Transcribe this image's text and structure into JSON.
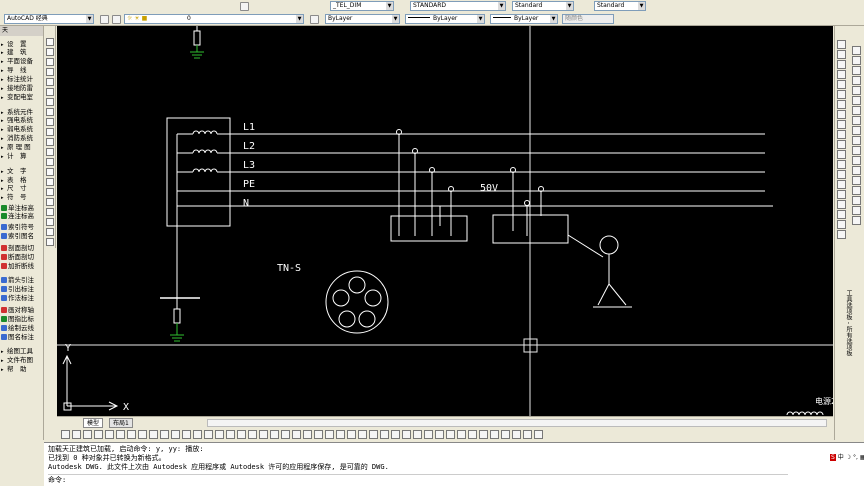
{
  "toolbar": {
    "workspace": "AutoCAD 经典",
    "layer": "0",
    "dim_style": "_TEL_DIM",
    "text_style": "STANDARD",
    "table_style": "Standard",
    "multileader_style": "Standard",
    "color": "ByLayer",
    "linetype": "ByLayer",
    "lineweight": "ByLayer",
    "plot_style": "随颜色"
  },
  "left_menu": {
    "header": "天",
    "items": [
      {
        "label": "设　置",
        "color": "#ffffff"
      },
      {
        "label": "建　筑",
        "color": "#ffffff"
      },
      {
        "label": "平面设备",
        "color": "#ffffff"
      },
      {
        "label": "导　线",
        "color": "#ffffff"
      },
      {
        "label": "标注统计",
        "color": "#ffffff"
      },
      {
        "label": "接地防雷",
        "color": "#ffffff"
      },
      {
        "label": "变配电室",
        "color": "#ffffff"
      },
      {
        "label": "系统元件",
        "color": "#ffffff"
      },
      {
        "label": "强电系统",
        "color": "#ffffff"
      },
      {
        "label": "弱电系统",
        "color": "#ffffff"
      },
      {
        "label": "消防系统",
        "color": "#ffffff"
      },
      {
        "label": "原 理 图",
        "color": "#ffffff"
      },
      {
        "label": "计　算",
        "color": "#ffffff"
      },
      {
        "label": "文　字",
        "color": "#ffffff"
      },
      {
        "label": "表　格",
        "color": "#ffffff"
      },
      {
        "label": "尺　寸",
        "color": "#ffffff"
      },
      {
        "label": "符　号",
        "color": "#ffffff"
      },
      {
        "label": "单注标高",
        "color": "#1a8a2a"
      },
      {
        "label": "连注标高",
        "color": "#1a8a2a"
      },
      {
        "label": "索引符号",
        "color": "#3a6ad0"
      },
      {
        "label": "索引图名",
        "color": "#3a6ad0"
      },
      {
        "label": "剖面剖切",
        "color": "#d03030"
      },
      {
        "label": "断面剖切",
        "color": "#d03030"
      },
      {
        "label": "加折断线",
        "color": "#d03030"
      },
      {
        "label": "箭头引注",
        "color": "#3a6ad0"
      },
      {
        "label": "引出标注",
        "color": "#3a6ad0"
      },
      {
        "label": "作法标注",
        "color": "#3a6ad0"
      },
      {
        "label": "画对称轴",
        "color": "#d03030"
      },
      {
        "label": "图指比标",
        "color": "#1a8a2a"
      },
      {
        "label": "绘制云线",
        "color": "#3a6ad0"
      },
      {
        "label": "图名标注",
        "color": "#3a6ad0"
      },
      {
        "label": "绘图工具",
        "color": "#ffffff"
      },
      {
        "label": "文件布图",
        "color": "#ffffff"
      },
      {
        "label": "帮　助",
        "color": "#ffffff"
      }
    ]
  },
  "drawing": {
    "phase_labels": [
      "L1",
      "L2",
      "L3",
      "PE",
      "N"
    ],
    "system_label": "TN-S",
    "voltage_label": "50V",
    "axis_y": "Y",
    "axis_x": "X",
    "corner_label": "电源2"
  },
  "tabs": [
    "模型",
    "布局1"
  ],
  "right_panel_text": "工具选项板 - 所有选项板",
  "command": {
    "lines": [
      "加载天正建筑已加载, 启动命令: y, yy: 播放:",
      "已找到 0 种对象并已转换为新格式。",
      "Autodesk DWG.  此文件上次由 Autodesk 应用程序或 Autodesk 许可的应用程序保存, 是可靠的 DWG."
    ],
    "prompt": "命令:"
  }
}
